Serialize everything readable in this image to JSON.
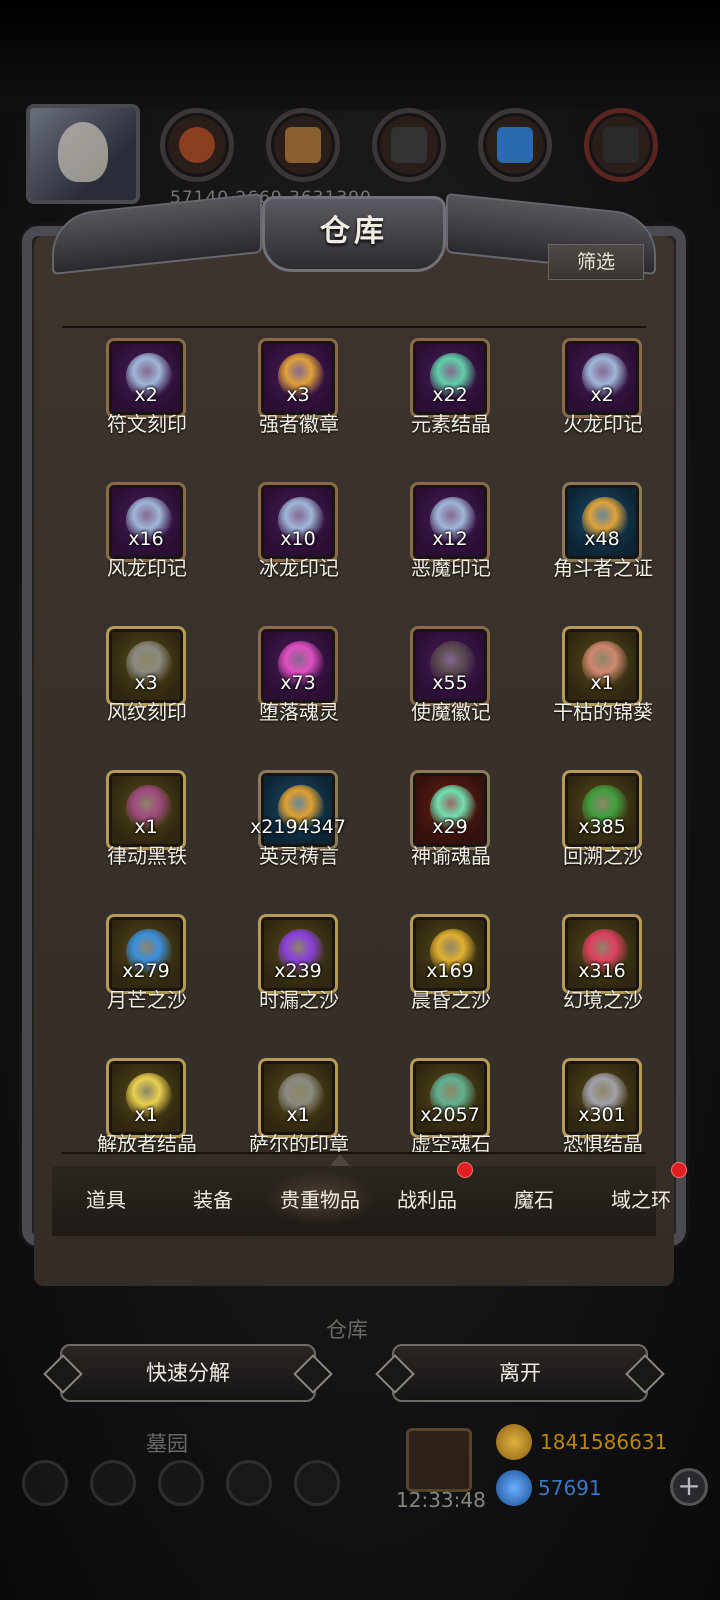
{
  "header": {
    "resource_numbers": "57140 2669    3631390",
    "resource_icons": [
      "bread-icon",
      "wood-icon",
      "stone-icon",
      "crystal-icon",
      "iron-icon"
    ]
  },
  "panel": {
    "title": "仓库",
    "filter_label": "筛选"
  },
  "items": [
    {
      "name": "符文刻印",
      "count": "x2",
      "frame": "purple",
      "icon": "rune-swirl-icon",
      "color": "#9fb6d8"
    },
    {
      "name": "强者徽章",
      "count": "x3",
      "frame": "purple",
      "icon": "gold-badge-icon",
      "color": "#e0a23a"
    },
    {
      "name": "元素结晶",
      "count": "x22",
      "frame": "purple",
      "icon": "crystal-shard-icon",
      "color": "#5fd0a8"
    },
    {
      "name": "火龙印记",
      "count": "x2",
      "frame": "purple",
      "icon": "rune-swirl-icon",
      "color": "#9fb6d8"
    },
    {
      "name": "风龙印记",
      "count": "x16",
      "frame": "purple",
      "icon": "rune-swirl-icon",
      "color": "#9fb6d8"
    },
    {
      "name": "冰龙印记",
      "count": "x10",
      "frame": "purple",
      "icon": "rune-swirl-icon",
      "color": "#9fb6d8"
    },
    {
      "name": "恶魔印记",
      "count": "x12",
      "frame": "purple",
      "icon": "rune-swirl-icon",
      "color": "#9fb6d8"
    },
    {
      "name": "角斗者之证",
      "count": "x48",
      "frame": "blue",
      "icon": "gold-badge-icon",
      "color": "#e0a23a"
    },
    {
      "name": "风纹刻印",
      "count": "x3",
      "frame": "gold",
      "icon": "stone-tablet-icon",
      "color": "#8a8a80"
    },
    {
      "name": "堕落魂灵",
      "count": "x73",
      "frame": "purple",
      "icon": "pink-soul-icon",
      "color": "#e050c0"
    },
    {
      "name": "使魔徽记",
      "count": "x55",
      "frame": "purple",
      "icon": "dark-emblem-icon",
      "color": "#5a4a50"
    },
    {
      "name": "干枯的锦葵",
      "count": "x1",
      "frame": "gold",
      "icon": "leaf-icon",
      "color": "#d08870"
    },
    {
      "name": "律动黑铁",
      "count": "x1",
      "frame": "gold",
      "icon": "iron-ingot-icon",
      "color": "#a04a80"
    },
    {
      "name": "英灵祷言",
      "count": "x2194347",
      "frame": "blue",
      "icon": "golden-orb-icon",
      "color": "#e0a030"
    },
    {
      "name": "神谕魂晶",
      "count": "x29",
      "frame": "red",
      "icon": "green-crystal-icon",
      "color": "#70e0b0"
    },
    {
      "name": "回溯之沙",
      "count": "x385",
      "frame": "gold",
      "icon": "green-sand-icon",
      "color": "#40a040"
    },
    {
      "name": "月芒之沙",
      "count": "x279",
      "frame": "gold",
      "icon": "blue-sand-icon",
      "color": "#3a90e0"
    },
    {
      "name": "时漏之沙",
      "count": "x239",
      "frame": "gold",
      "icon": "purple-sand-icon",
      "color": "#8a40e0"
    },
    {
      "name": "晨昏之沙",
      "count": "x169",
      "frame": "gold",
      "icon": "gold-sand-icon",
      "color": "#e0b030"
    },
    {
      "name": "幻境之沙",
      "count": "x316",
      "frame": "gold",
      "icon": "red-sand-icon",
      "color": "#e04060"
    },
    {
      "name": "解放者结晶",
      "count": "x1",
      "frame": "gold",
      "icon": "yellow-crystal-icon",
      "color": "#e8d050"
    },
    {
      "name": "萨尔的印章",
      "count": "x1",
      "frame": "gold",
      "icon": "stone-tablet-icon",
      "color": "#8a8a80"
    },
    {
      "name": "虚空魂石",
      "count": "x2057",
      "frame": "gold",
      "icon": "void-stone-icon",
      "color": "#60b090"
    },
    {
      "name": "恐惧结晶",
      "count": "x301",
      "frame": "gold",
      "icon": "fear-crystal-icon",
      "color": "#a0a0a8"
    }
  ],
  "tabs": [
    {
      "label": "道具",
      "badge": false,
      "active": false
    },
    {
      "label": "装备",
      "badge": false,
      "active": false
    },
    {
      "label": "贵重物品",
      "badge": false,
      "active": true
    },
    {
      "label": "战利品",
      "badge": true,
      "active": false
    },
    {
      "label": "魔石",
      "badge": false,
      "active": false
    },
    {
      "label": "域之环",
      "badge": true,
      "active": false
    }
  ],
  "lower": {
    "warehouse_label": "仓库",
    "graveyard_label": "墓园",
    "quick_decompose": "快速分解",
    "leave": "离开",
    "time": "12:33:48",
    "gold": "1841586631",
    "gems": "57691",
    "plus": "+"
  },
  "colors": {
    "badge_red": "#e02020",
    "gold_text": "#b8860b",
    "gem_text": "#3a78c0"
  }
}
